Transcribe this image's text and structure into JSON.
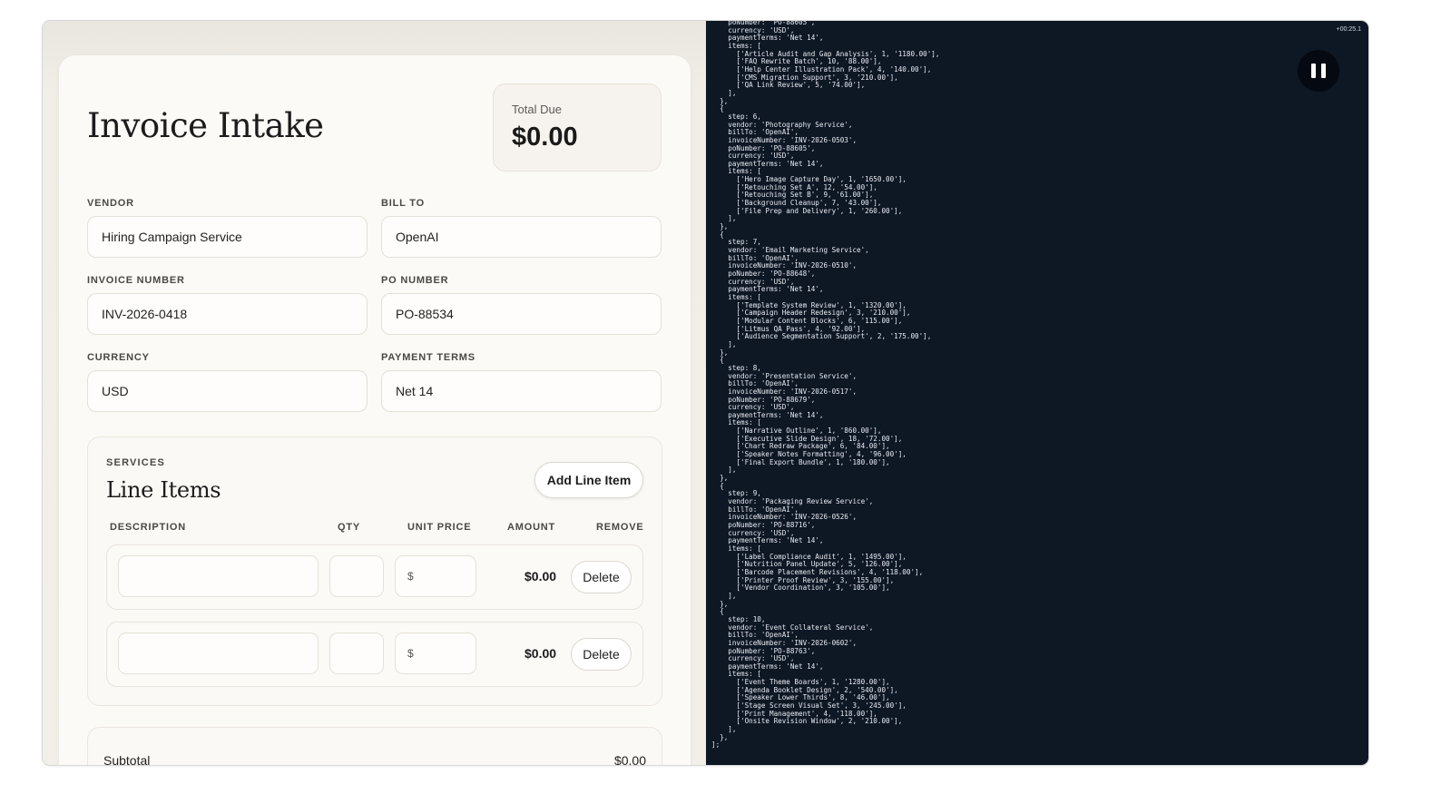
{
  "form": {
    "title": "Invoice Intake",
    "total_due_label": "Total Due",
    "total_due_value": "$0.00",
    "fields": {
      "vendor": {
        "label": "VENDOR",
        "value": "Hiring Campaign Service"
      },
      "bill_to": {
        "label": "BILL TO",
        "value": "OpenAI"
      },
      "invoice_number": {
        "label": "INVOICE NUMBER",
        "value": "INV-2026-0418"
      },
      "po_number": {
        "label": "PO NUMBER",
        "value": "PO-88534"
      },
      "currency": {
        "label": "CURRENCY",
        "value": "USD"
      },
      "payment_terms": {
        "label": "PAYMENT TERMS",
        "value": "Net 14"
      }
    },
    "services": {
      "eyebrow": "SERVICES",
      "title": "Line Items",
      "add_button": "Add Line Item",
      "columns": {
        "description": "DESCRIPTION",
        "qty": "QTY",
        "unit_price": "UNIT PRICE",
        "amount": "AMOUNT",
        "remove": "REMOVE"
      },
      "rows": [
        {
          "description": "",
          "qty": "",
          "unit_prefix": "$",
          "unit_price": "",
          "amount": "$0.00",
          "delete_label": "Delete"
        },
        {
          "description": "",
          "qty": "",
          "unit_prefix": "$",
          "unit_price": "",
          "amount": "$0.00",
          "delete_label": "Delete"
        }
      ]
    },
    "summary": {
      "subtotal_label": "Subtotal",
      "subtotal_value": "$0.00"
    }
  },
  "console": {
    "timer": "+00:25.1",
    "pause_icon": "pause-icon",
    "code": "    poNumber: 'PO-88605',\n    currency: 'USD',\n    paymentTerms: 'Net 14',\n    items: [\n      ['Article Audit and Gap Analysis', 1, '1180.00'],\n      ['FAQ Rewrite Batch', 10, '88.00'],\n      ['Help Center Illustration Pack', 4, '140.00'],\n      ['CMS Migration Support', 3, '210.00'],\n      ['QA Link Review', 5, '74.00'],\n    ],\n  },\n  {\n    step: 6,\n    vendor: 'Photography Service',\n    billTo: 'OpenAI',\n    invoiceNumber: 'INV-2026-0503',\n    poNumber: 'PO-88605',\n    currency: 'USD',\n    paymentTerms: 'Net 14',\n    items: [\n      ['Hero Image Capture Day', 1, '1650.00'],\n      ['Retouching Set A', 12, '54.00'],\n      ['Retouching Set B', 9, '61.00'],\n      ['Background Cleanup', 7, '43.00'],\n      ['File Prep and Delivery', 1, '260.00'],\n    ],\n  },\n  {\n    step: 7,\n    vendor: 'Email Marketing Service',\n    billTo: 'OpenAI',\n    invoiceNumber: 'INV-2026-0510',\n    poNumber: 'PO-88648',\n    currency: 'USD',\n    paymentTerms: 'Net 14',\n    items: [\n      ['Template System Review', 1, '1320.00'],\n      ['Campaign Header Redesign', 3, '210.00'],\n      ['Modular Content Blocks', 6, '115.00'],\n      ['Litmus QA Pass', 4, '92.00'],\n      ['Audience Segmentation Support', 2, '175.00'],\n    ],\n  },\n  {\n    step: 8,\n    vendor: 'Presentation Service',\n    billTo: 'OpenAI',\n    invoiceNumber: 'INV-2026-0517',\n    poNumber: 'PO-88679',\n    currency: 'USD',\n    paymentTerms: 'Net 14',\n    items: [\n      ['Narrative Outline', 1, '860.00'],\n      ['Executive Slide Design', 18, '72.00'],\n      ['Chart Redraw Package', 6, '84.00'],\n      ['Speaker Notes Formatting', 4, '96.00'],\n      ['Final Export Bundle', 1, '180.00'],\n    ],\n  },\n  {\n    step: 9,\n    vendor: 'Packaging Review Service',\n    billTo: 'OpenAI',\n    invoiceNumber: 'INV-2026-0526',\n    poNumber: 'PO-88716',\n    currency: 'USD',\n    paymentTerms: 'Net 14',\n    items: [\n      ['Label Compliance Audit', 1, '1495.00'],\n      ['Nutrition Panel Update', 5, '126.00'],\n      ['Barcode Placement Revisions', 4, '118.00'],\n      ['Printer Proof Review', 3, '155.00'],\n      ['Vendor Coordination', 3, '105.00'],\n    ],\n  },\n  {\n    step: 10,\n    vendor: 'Event Collateral Service',\n    billTo: 'OpenAI',\n    invoiceNumber: 'INV-2026-0602',\n    poNumber: 'PO-88763',\n    currency: 'USD',\n    paymentTerms: 'Net 14',\n    items: [\n      ['Event Theme Boards', 1, '1280.00'],\n      ['Agenda Booklet Design', 2, '540.00'],\n      ['Speaker Lower Thirds', 8, '46.00'],\n      ['Stage Screen Visual Set', 3, '245.00'],\n      ['Print Management', 4, '118.00'],\n      ['Onsite Revision Window', 2, '210.00'],\n    ],\n  },\n];"
  }
}
